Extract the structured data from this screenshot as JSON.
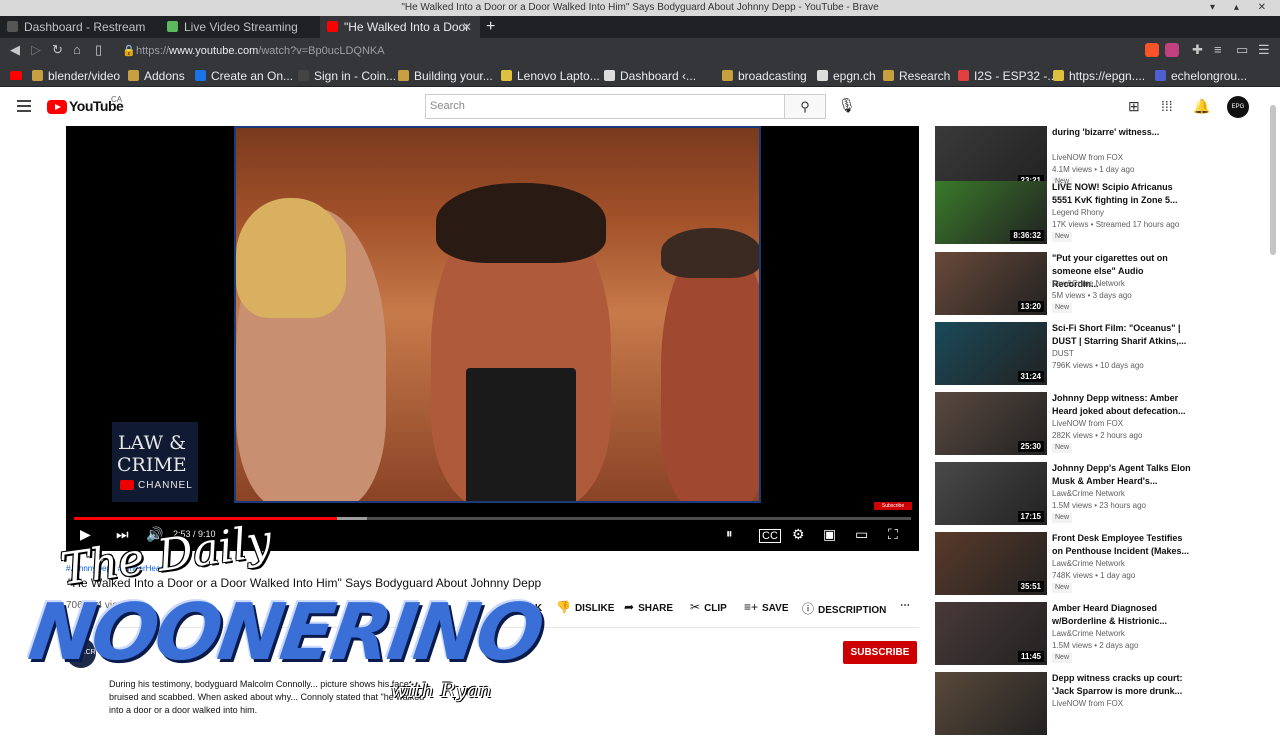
{
  "window": {
    "title": "\"He Walked Into a Door or a Door Walked Into Him\" Says Bodyguard About Johnny Depp - YouTube - Brave"
  },
  "tabs": [
    {
      "label": "Dashboard - Restream",
      "color": "#555555"
    },
    {
      "label": "Live Video Streaming",
      "color": "#5bb85b"
    },
    {
      "label": "\"He Walked Into a Door",
      "color": "#ff0000"
    }
  ],
  "address": {
    "prefix": "https://",
    "host": "www.youtube.com",
    "path": "/watch?v=Bp0ucLDQNKA"
  },
  "bookmarks": [
    {
      "label": "blender/video",
      "color": "#c8a040"
    },
    {
      "label": "Addons",
      "color": "#c8a040"
    },
    {
      "label": "Create an On...",
      "color": "#1a73e8"
    },
    {
      "label": "Sign in - Coin...",
      "color": "#444444"
    },
    {
      "label": "Building your...",
      "color": "#c8a040"
    },
    {
      "label": "Lenovo Lapto...",
      "color": "#e0c040"
    },
    {
      "label": "Dashboard ‹...",
      "color": "#dddddd"
    },
    {
      "label": "broadcasting",
      "color": "#c8a040"
    },
    {
      "label": "epgn.ch",
      "color": "#dddddd"
    },
    {
      "label": "Research",
      "color": "#c8a040"
    },
    {
      "label": "I2S - ESP32 -...",
      "color": "#e04040"
    },
    {
      "label": "https://epgn....",
      "color": "#e0c040"
    },
    {
      "label": "echelongrou...",
      "color": "#5060d0"
    }
  ],
  "youtube": {
    "logo": "YouTube",
    "region": "CA",
    "search_placeholder": "Search"
  },
  "video": {
    "current_time": "2:53",
    "duration": "9:10",
    "time_display": "2:53 / 9:10",
    "progress_fraction": 0.314,
    "buffered_fraction": 0.31,
    "watermark": {
      "line1": "LAW &",
      "line2": "CRIME",
      "channel": "CHANNEL"
    },
    "subscribe_watermark": "Subscribe"
  },
  "below": {
    "hashtags": "#JohnnyDepp #AmberHeard",
    "title": "\"He Walked Into a Door or a Door Walked Into Him\" Says Bodyguard About Johnny Depp",
    "views": "706,064 views",
    "actions": {
      "like": "1.9K",
      "dislike": "DISLIKE",
      "share": "SHARE",
      "clip": "CLIP",
      "save": "SAVE",
      "description": "DESCRIPTION"
    },
    "subscribe": "SUBSCRIBE",
    "channel_avatar": "LAW&CRIME",
    "description": "During his testimony, bodyguard Malcolm Connolly... picture shows his face bruised and scabbed. When asked about why... Connoly stated that \"he walked into a door or a door walked into him."
  },
  "overlay": {
    "line1": "The Daily",
    "line2": "NOONERINO",
    "line3": "with Ryan"
  },
  "sidebar": [
    {
      "title": "during 'bizarre' witness...",
      "channel": "LiveNOW from FOX",
      "meta": "4.1M views • 1 day ago",
      "badge": "New",
      "duration": "23:21",
      "thumb": "#3a3a3a"
    },
    {
      "title": "LIVE NOW! Scipio Africanus 5551 KvK fighting in Zone 5...",
      "channel": "Legend Rhony",
      "meta": "17K views • Streamed 17 hours ago",
      "badge": "New",
      "duration": "8:36:32",
      "thumb": "#3a7a2a"
    },
    {
      "title": "\"Put your cigarettes out on someone else\" Audio Recordin...",
      "channel": "Law&Crime Network",
      "meta": "5M views • 3 days ago",
      "badge": "New",
      "duration": "13:20",
      "thumb": "#6a4a3a"
    },
    {
      "title": "Sci-Fi Short Film: \"Oceanus\" | DUST | Starring Sharif Atkins,...",
      "channel": "DUST",
      "meta": "796K views • 10 days ago",
      "badge": "",
      "duration": "31:24",
      "thumb": "#1a4a5a"
    },
    {
      "title": "Johnny Depp witness: Amber Heard joked about defecation...",
      "channel": "LiveNOW from FOX",
      "meta": "282K views • 2 hours ago",
      "badge": "New",
      "duration": "25:30",
      "thumb": "#5a4a40"
    },
    {
      "title": "Johnny Depp's Agent Talks Elon Musk & Amber Heard's...",
      "channel": "Law&Crime Network",
      "meta": "1.5M views • 23 hours ago",
      "badge": "New",
      "duration": "17:15",
      "thumb": "#4a4a4a"
    },
    {
      "title": "Front Desk Employee Testifies on Penthouse Incident (Makes...",
      "channel": "Law&Crime Network",
      "meta": "748K views • 1 day ago",
      "badge": "New",
      "duration": "35:51",
      "thumb": "#5a3a2a"
    },
    {
      "title": "Amber Heard Diagnosed w/Borderline & Histrionic...",
      "channel": "Law&Crime Network",
      "meta": "1.5M views • 2 days ago",
      "badge": "New",
      "duration": "11:45",
      "thumb": "#4a3a3a"
    },
    {
      "title": "Depp witness cracks up court: 'Jack Sparrow is more drunk...",
      "channel": "LiveNOW from FOX",
      "meta": "",
      "badge": "",
      "duration": "",
      "thumb": "#5a4a3a"
    }
  ]
}
